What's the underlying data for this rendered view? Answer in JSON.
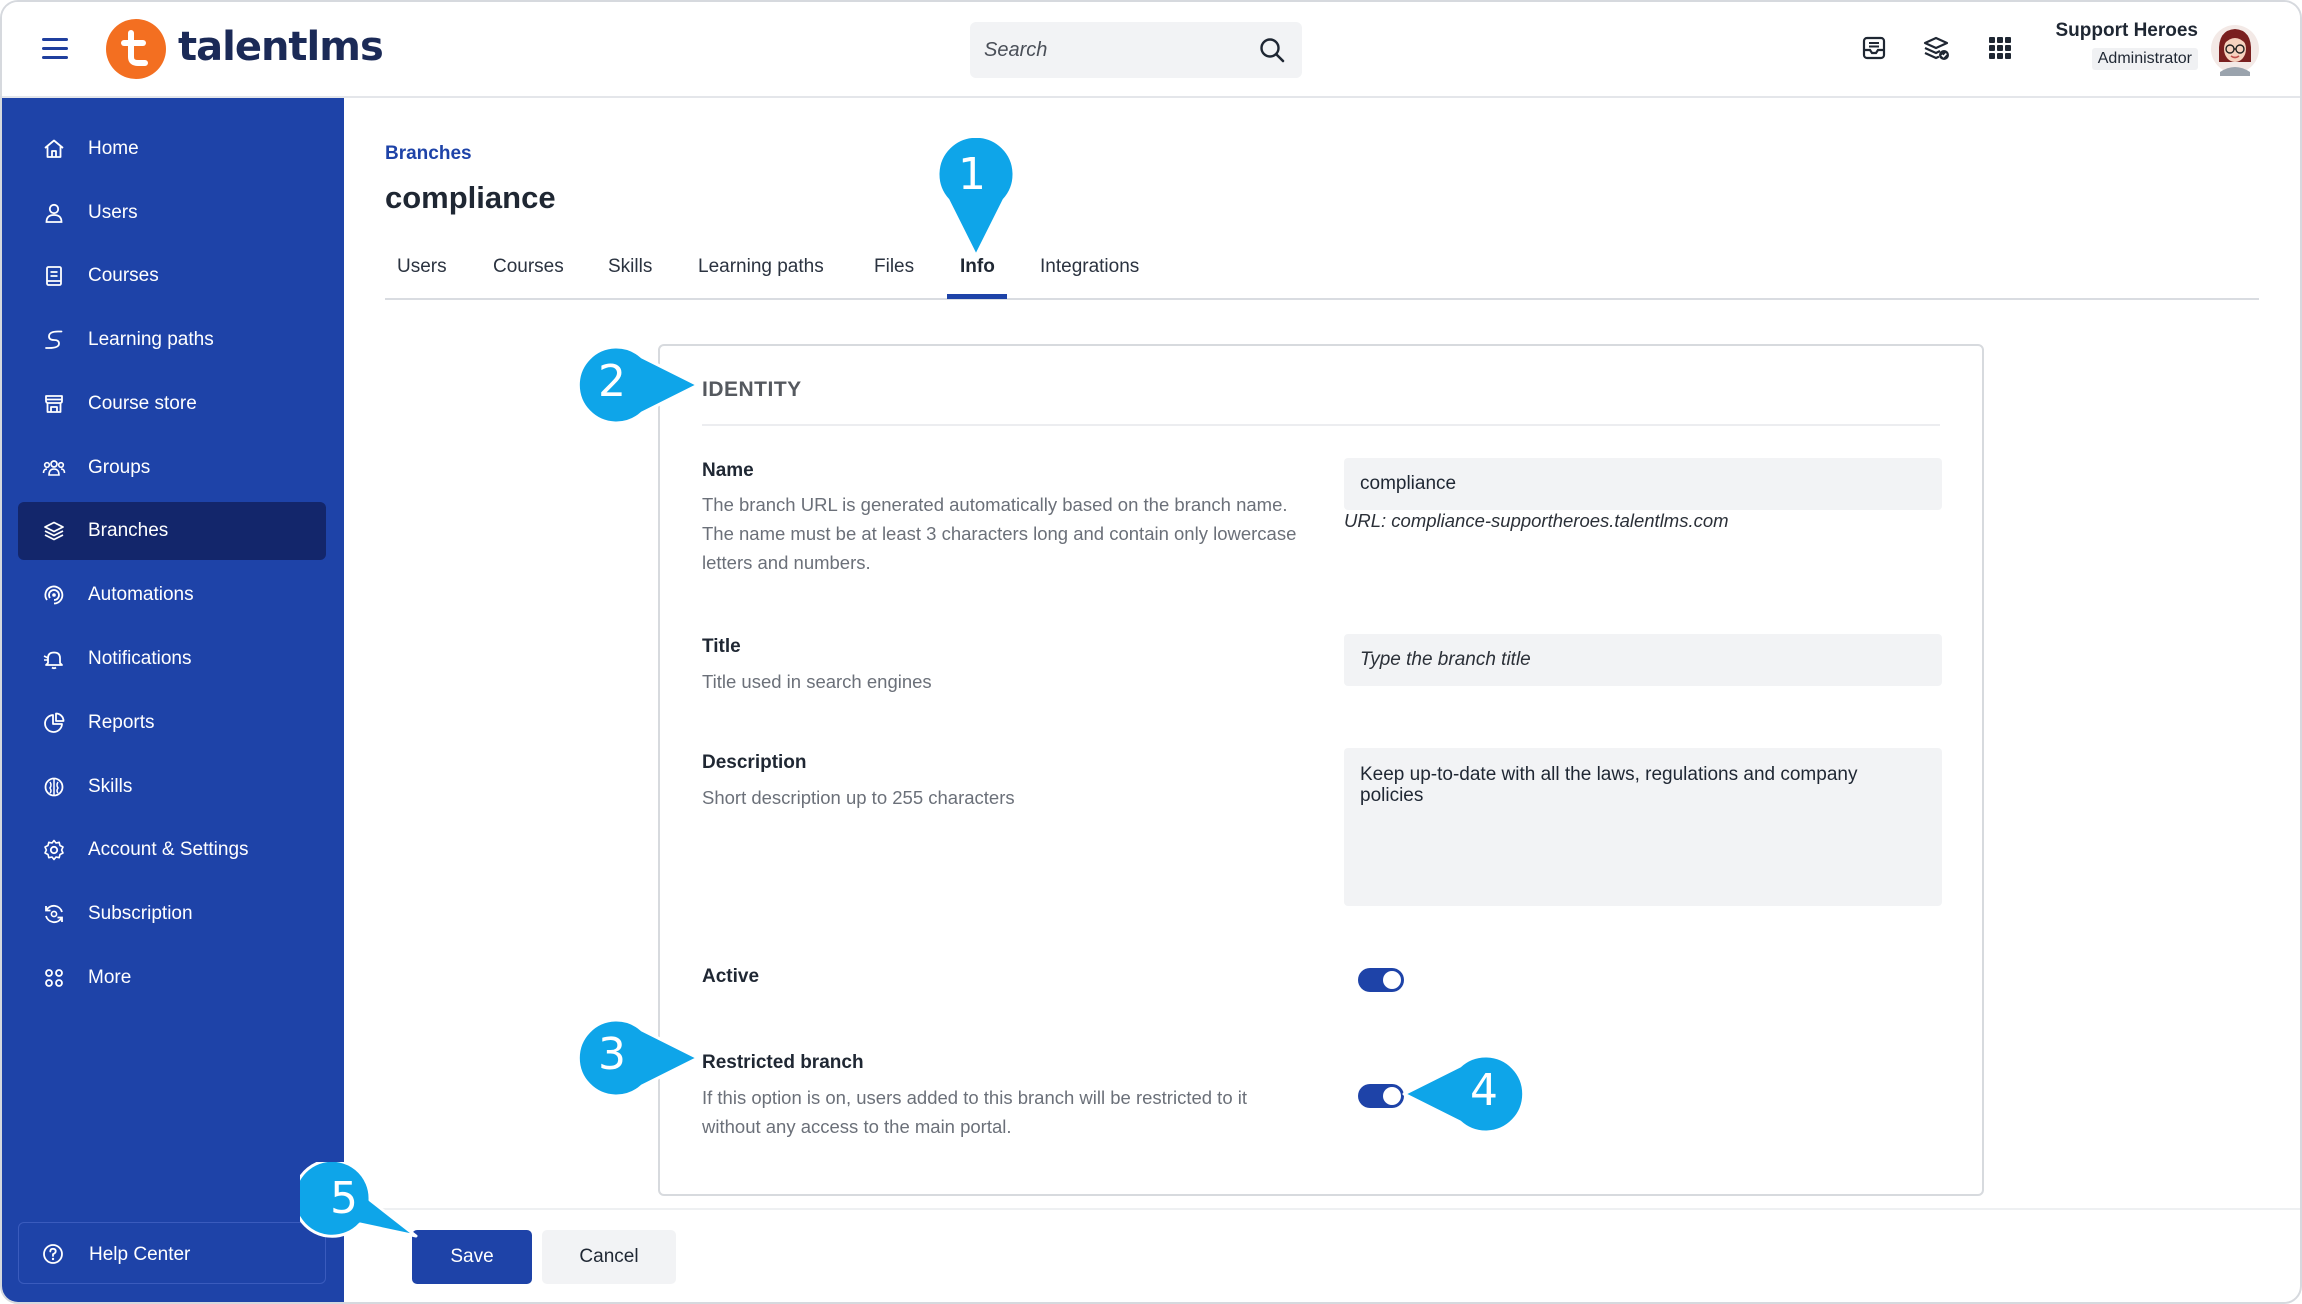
{
  "header": {
    "logo_text": "talentlms",
    "search": {
      "placeholder": "Search"
    },
    "user": {
      "name": "Support Heroes",
      "role": "Administrator"
    },
    "icons": [
      "inbox-icon",
      "layers-check-icon",
      "apps-grid-icon"
    ]
  },
  "sidebar": {
    "items": [
      {
        "label": "Home",
        "icon": "home-icon"
      },
      {
        "label": "Users",
        "icon": "user-icon"
      },
      {
        "label": "Courses",
        "icon": "courses-icon"
      },
      {
        "label": "Learning paths",
        "icon": "learning-path-icon"
      },
      {
        "label": "Course store",
        "icon": "store-icon"
      },
      {
        "label": "Groups",
        "icon": "groups-icon"
      },
      {
        "label": "Branches",
        "icon": "branches-icon",
        "active": true
      },
      {
        "label": "Automations",
        "icon": "automations-icon"
      },
      {
        "label": "Notifications",
        "icon": "notifications-icon"
      },
      {
        "label": "Reports",
        "icon": "reports-icon"
      },
      {
        "label": "Skills",
        "icon": "skills-icon"
      },
      {
        "label": "Account & Settings",
        "icon": "settings-icon"
      },
      {
        "label": "Subscription",
        "icon": "subscription-icon"
      },
      {
        "label": "More",
        "icon": "more-icon"
      }
    ],
    "help": {
      "label": "Help Center",
      "icon": "help-icon"
    }
  },
  "main": {
    "breadcrumb": "Branches",
    "title": "compliance",
    "tabs": [
      "Users",
      "Courses",
      "Skills",
      "Learning paths",
      "Files",
      "Info",
      "Integrations"
    ],
    "active_tab": "Info",
    "identity": {
      "section_title": "IDENTITY",
      "name": {
        "label": "Name",
        "help": "The branch URL is generated automatically based on the branch name. The name must be at least 3 characters long and contain only lowercase letters and numbers.",
        "value": "compliance",
        "url_note": "URL: compliance-supportheroes.talentlms.com"
      },
      "title_field": {
        "label": "Title",
        "help": "Title used in search engines",
        "placeholder": "Type the branch title"
      },
      "description": {
        "label": "Description",
        "help": "Short description up to 255 characters",
        "value": "Keep up-to-date with all the laws, regulations and company policies"
      },
      "active": {
        "label": "Active",
        "on": true
      },
      "restricted": {
        "label": "Restricted branch",
        "help": "If this option is on, users added to this branch will be restricted to it without any access to the main portal.",
        "on": true
      }
    },
    "actions": {
      "save": "Save",
      "cancel": "Cancel"
    }
  },
  "callouts": [
    "1",
    "2",
    "3",
    "4",
    "5"
  ],
  "colors": {
    "brand_blue": "#1e43a8",
    "sidebar_active": "#13266b",
    "logo_orange": "#f36f21",
    "callout_cyan": "#0ea5e9"
  }
}
